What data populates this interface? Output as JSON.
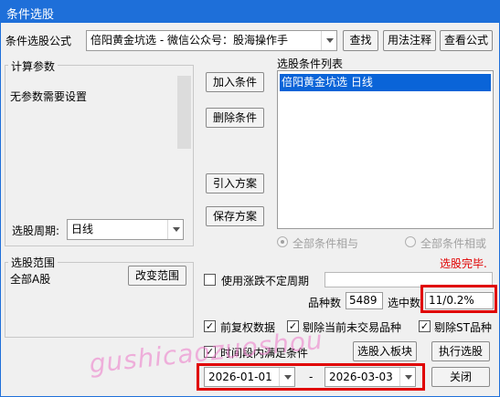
{
  "window": {
    "title": "条件选股"
  },
  "formula": {
    "label": "条件选股公式",
    "value": "倍阳黄金坑选  -  微信公众号：股海操作手",
    "buttons": {
      "find": "查找",
      "usage": "用法注释",
      "view": "查看公式"
    }
  },
  "params": {
    "group_title": "计算参数",
    "text": "无参数需要设置",
    "period_label": "选股周期:",
    "period_value": "日线"
  },
  "actions": {
    "add": "加入条件",
    "delete": "删除条件",
    "import": "引入方案",
    "save": "保存方案"
  },
  "conditions": {
    "title": "选股条件列表",
    "items": [
      "倍阳黄金坑选  日线"
    ],
    "radio_and": "全部条件相与",
    "radio_or": "全部条件相或",
    "status": "选股完毕."
  },
  "scope": {
    "group_title": "选股范围",
    "value": "全部A股",
    "change_button": "改变范围"
  },
  "options": {
    "use_variable_period": "使用涨跌不定周期",
    "variety_count_label": "品种数",
    "variety_count": "5489",
    "selected_label": "选中数",
    "selected_value": "11/0.2%",
    "pre_adjust": "前复权数据",
    "exclude_untraded": "剔除当前未交易品种",
    "exclude_st": "剔除ST品种",
    "time_range": "时间段内满足条件",
    "to_block": "选股入板块",
    "execute": "执行选股",
    "close": "关闭"
  },
  "dates": {
    "start": "2026-01-01",
    "separator": "-",
    "end": "2026-03-03"
  },
  "watermark": "gushicaozuoshou",
  "colors": {
    "titlebar": "#1e6fd9",
    "selection": "#0a64d8",
    "highlight_box": "#e00000",
    "status": "#e00000"
  }
}
